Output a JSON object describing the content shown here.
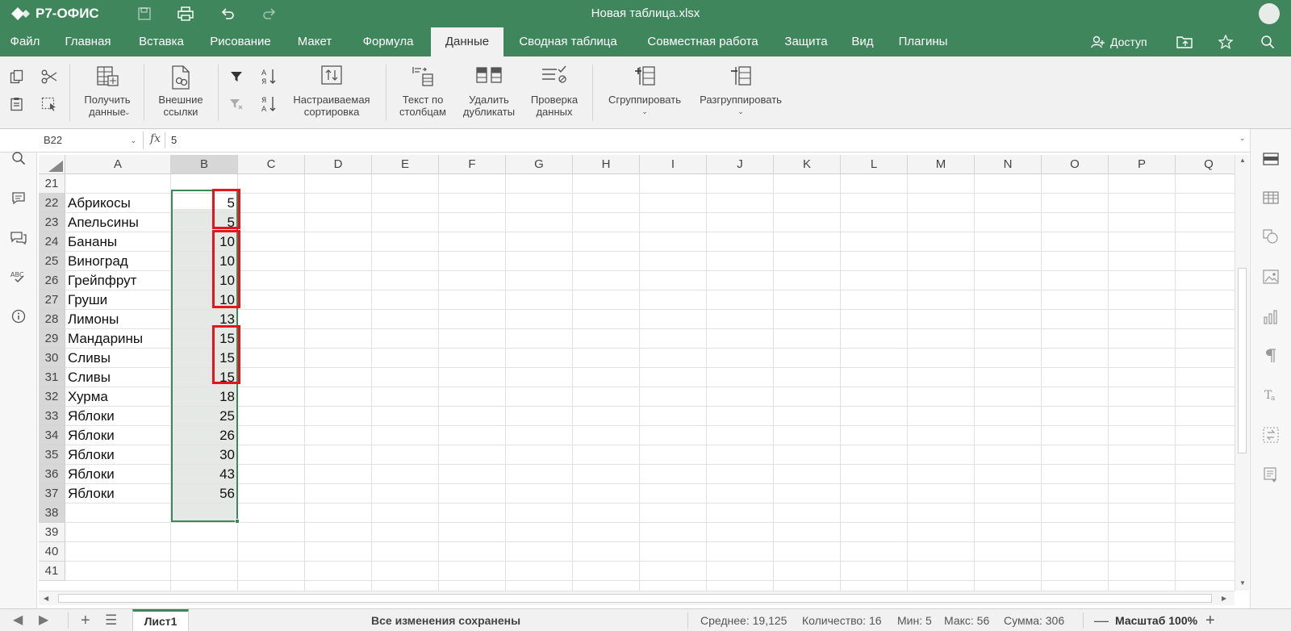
{
  "app": {
    "logo_text": "Р7-ОФИС",
    "doc_title": "Новая таблица.xlsx"
  },
  "menu": {
    "tabs": [
      "Файл",
      "Главная",
      "Вставка",
      "Рисование",
      "Макет",
      "Формула",
      "Данные",
      "Сводная таблица",
      "Совместная работа",
      "Защита",
      "Вид",
      "Плагины"
    ],
    "active_tab": "Данные",
    "access_label": "Доступ"
  },
  "ribbon": {
    "get_data": "Получить\nданные",
    "external_links": "Внешние\nссылки",
    "custom_sort": "Настраиваемая\nсортировка",
    "text_to_columns": "Текст по\nстолбцам",
    "remove_duplicates": "Удалить\nдубликаты",
    "data_validation": "Проверка\nданных",
    "group": "Сгруппировать",
    "ungroup": "Разгруппировать"
  },
  "formula_bar": {
    "cell_ref": "B22",
    "fx_label": "fx",
    "value": "5"
  },
  "grid": {
    "columns": [
      "A",
      "B",
      "C",
      "D",
      "E",
      "F",
      "G",
      "H",
      "I",
      "J",
      "K",
      "L",
      "M",
      "N",
      "O",
      "P",
      "Q"
    ],
    "selected_column": "B",
    "row_numbers": [
      "21",
      "22",
      "23",
      "24",
      "25",
      "26",
      "27",
      "28",
      "29",
      "30",
      "31",
      "32",
      "33",
      "34",
      "35",
      "36",
      "37",
      "38",
      "39",
      "40",
      "41"
    ],
    "data_rows": [
      {
        "row": "22",
        "a": "Абрикосы",
        "b": "5"
      },
      {
        "row": "23",
        "a": "Апельсины",
        "b": "5"
      },
      {
        "row": "24",
        "a": "Бананы",
        "b": "10"
      },
      {
        "row": "25",
        "a": "Виноград",
        "b": "10"
      },
      {
        "row": "26",
        "a": "Грейпфрут",
        "b": "10"
      },
      {
        "row": "27",
        "a": "Груши",
        "b": "10"
      },
      {
        "row": "28",
        "a": "Лимоны",
        "b": "13"
      },
      {
        "row": "29",
        "a": "Мандарины",
        "b": "15"
      },
      {
        "row": "30",
        "a": "Сливы",
        "b": "15"
      },
      {
        "row": "31",
        "a": "Сливы",
        "b": "15"
      },
      {
        "row": "32",
        "a": "Хурма",
        "b": "18"
      },
      {
        "row": "33",
        "a": "Яблоки",
        "b": "25"
      },
      {
        "row": "34",
        "a": "Яблоки",
        "b": "26"
      },
      {
        "row": "35",
        "a": "Яблоки",
        "b": "30"
      },
      {
        "row": "36",
        "a": "Яблоки",
        "b": "43"
      },
      {
        "row": "37",
        "a": "Яблоки",
        "b": "56"
      }
    ],
    "selection": "B22:B38"
  },
  "status": {
    "sheet_name": "Лист1",
    "save_status": "Все изменения сохранены",
    "average": "Среднее: 19,125",
    "count": "Количество: 16",
    "min": "Мин: 5",
    "max": "Макс: 56",
    "sum": "Сумма: 306",
    "zoom": "Масштаб 100%"
  },
  "colors": {
    "brand": "#40865c",
    "highlight": "#e8141b",
    "selection_fill": "#e4e9e5"
  }
}
